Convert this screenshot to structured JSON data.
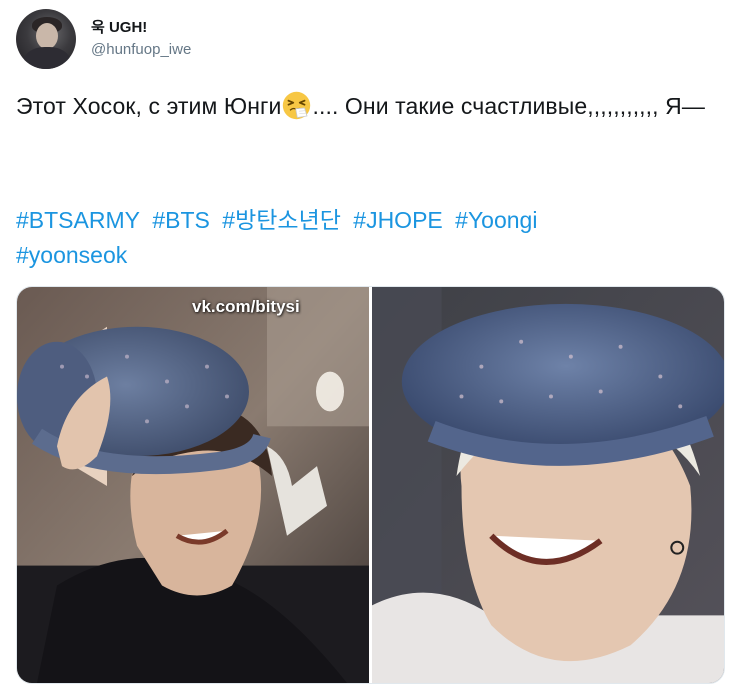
{
  "user": {
    "display_name": "욱 UGH!",
    "handle": "@hunfuop_iwe"
  },
  "tweet": {
    "text_part1": "Этот Хосок, с этим Юнги",
    "emoji_icon": "sneezing-face-emoji",
    "text_part2": ".... Они такие счастливые,,,,,,,,,,, Я—",
    "hashtags": [
      "#BTSARMY",
      "#BTS",
      "#방탄소년단",
      "#JHOPE",
      "#Yoongi",
      "#yoonseok"
    ]
  },
  "media": {
    "watermark": "vk.com/bitysi",
    "photos": [
      {
        "name": "photo-left"
      },
      {
        "name": "photo-right"
      }
    ]
  },
  "colors": {
    "text": "#14171a",
    "secondary": "#657786",
    "link": "#1b95e0",
    "border": "#e1e8ed"
  }
}
